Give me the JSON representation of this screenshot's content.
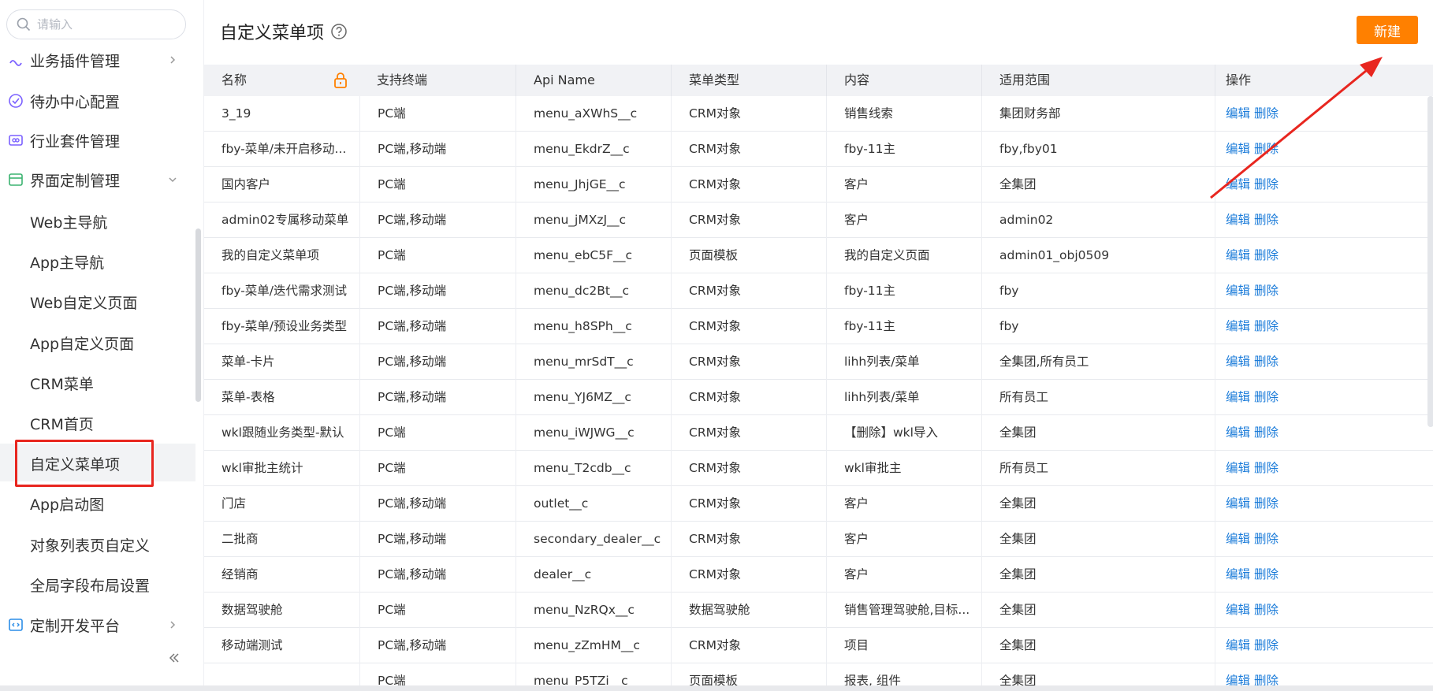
{
  "sidebar": {
    "search_placeholder": "请输入",
    "items": [
      {
        "label": "业务插件管理"
      },
      {
        "label": "待办中心配置"
      },
      {
        "label": "行业套件管理"
      },
      {
        "label": "界面定制管理"
      },
      {
        "label": "定制开发平台"
      }
    ],
    "sub_items": [
      {
        "label": "Web主导航"
      },
      {
        "label": "App主导航"
      },
      {
        "label": "Web自定义页面"
      },
      {
        "label": "App自定义页面"
      },
      {
        "label": "CRM菜单"
      },
      {
        "label": "CRM首页"
      },
      {
        "label": "自定义菜单项"
      },
      {
        "label": "App启动图"
      },
      {
        "label": "对象列表页自定义"
      },
      {
        "label": "全局字段布局设置"
      }
    ],
    "accent_color": "#7b61ff",
    "highlight_color": "#e8261f"
  },
  "header": {
    "title": "自定义菜单项",
    "new_button": "新建",
    "new_button_color": "#ff8000"
  },
  "table": {
    "columns": [
      "名称",
      "支持终端",
      "Api Name",
      "菜单类型",
      "内容",
      "适用范围",
      "操作"
    ],
    "edit_label": "编辑",
    "delete_label": "删除",
    "rows": [
      {
        "name": "3_19",
        "terminal": "PC端",
        "api": "menu_aXWhS__c",
        "type": "CRM对象",
        "content": "销售线索",
        "scope": "集团财务部"
      },
      {
        "name": "fby-菜单/未开启移动...",
        "terminal": "PC端,移动端",
        "api": "menu_EkdrZ__c",
        "type": "CRM对象",
        "content": "fby-11主",
        "scope": "fby,fby01"
      },
      {
        "name": "国内客户",
        "terminal": "PC端",
        "api": "menu_JhjGE__c",
        "type": "CRM对象",
        "content": "客户",
        "scope": "全集团"
      },
      {
        "name": "admin02专属移动菜单",
        "terminal": "PC端,移动端",
        "api": "menu_jMXzJ__c",
        "type": "CRM对象",
        "content": "客户",
        "scope": "admin02"
      },
      {
        "name": "我的自定义菜单项",
        "terminal": "PC端",
        "api": "menu_ebC5F__c",
        "type": "页面模板",
        "content": "我的自定义页面",
        "scope": "admin01_obj0509"
      },
      {
        "name": "fby-菜单/迭代需求测试",
        "terminal": "PC端,移动端",
        "api": "menu_dc2Bt__c",
        "type": "CRM对象",
        "content": "fby-11主",
        "scope": "fby"
      },
      {
        "name": "fby-菜单/预设业务类型",
        "terminal": "PC端,移动端",
        "api": "menu_h8SPh__c",
        "type": "CRM对象",
        "content": "fby-11主",
        "scope": "fby"
      },
      {
        "name": "菜单-卡片",
        "terminal": "PC端,移动端",
        "api": "menu_mrSdT__c",
        "type": "CRM对象",
        "content": "lihh列表/菜单",
        "scope": "全集团,所有员工"
      },
      {
        "name": "菜单-表格",
        "terminal": "PC端,移动端",
        "api": "menu_YJ6MZ__c",
        "type": "CRM对象",
        "content": "lihh列表/菜单",
        "scope": "所有员工"
      },
      {
        "name": "wkl跟随业务类型-默认",
        "terminal": "PC端",
        "api": "menu_iWJWG__c",
        "type": "CRM对象",
        "content": "【删除】wkl导入",
        "scope": "全集团"
      },
      {
        "name": "wkl审批主统计",
        "terminal": "PC端",
        "api": "menu_T2cdb__c",
        "type": "CRM对象",
        "content": "wkl审批主",
        "scope": "所有员工"
      },
      {
        "name": "门店",
        "terminal": "PC端,移动端",
        "api": "outlet__c",
        "type": "CRM对象",
        "content": "客户",
        "scope": "全集团"
      },
      {
        "name": "二批商",
        "terminal": "PC端,移动端",
        "api": "secondary_dealer__c",
        "type": "CRM对象",
        "content": "客户",
        "scope": "全集团"
      },
      {
        "name": "经销商",
        "terminal": "PC端,移动端",
        "api": "dealer__c",
        "type": "CRM对象",
        "content": "客户",
        "scope": "全集团"
      },
      {
        "name": "数据驾驶舱",
        "terminal": "PC端",
        "api": "menu_NzRQx__c",
        "type": "数据驾驶舱",
        "content": "销售管理驾驶舱,目标...",
        "scope": "全集团"
      },
      {
        "name": "移动端测试",
        "terminal": "PC端,移动端",
        "api": "menu_zZmHM__c",
        "type": "CRM对象",
        "content": "项目",
        "scope": "全集团"
      },
      {
        "name": "",
        "terminal": "PC端",
        "api": "menu_P5TZi__c",
        "type": "页面模板",
        "content": "报表, 组件",
        "scope": "全集团"
      }
    ]
  }
}
